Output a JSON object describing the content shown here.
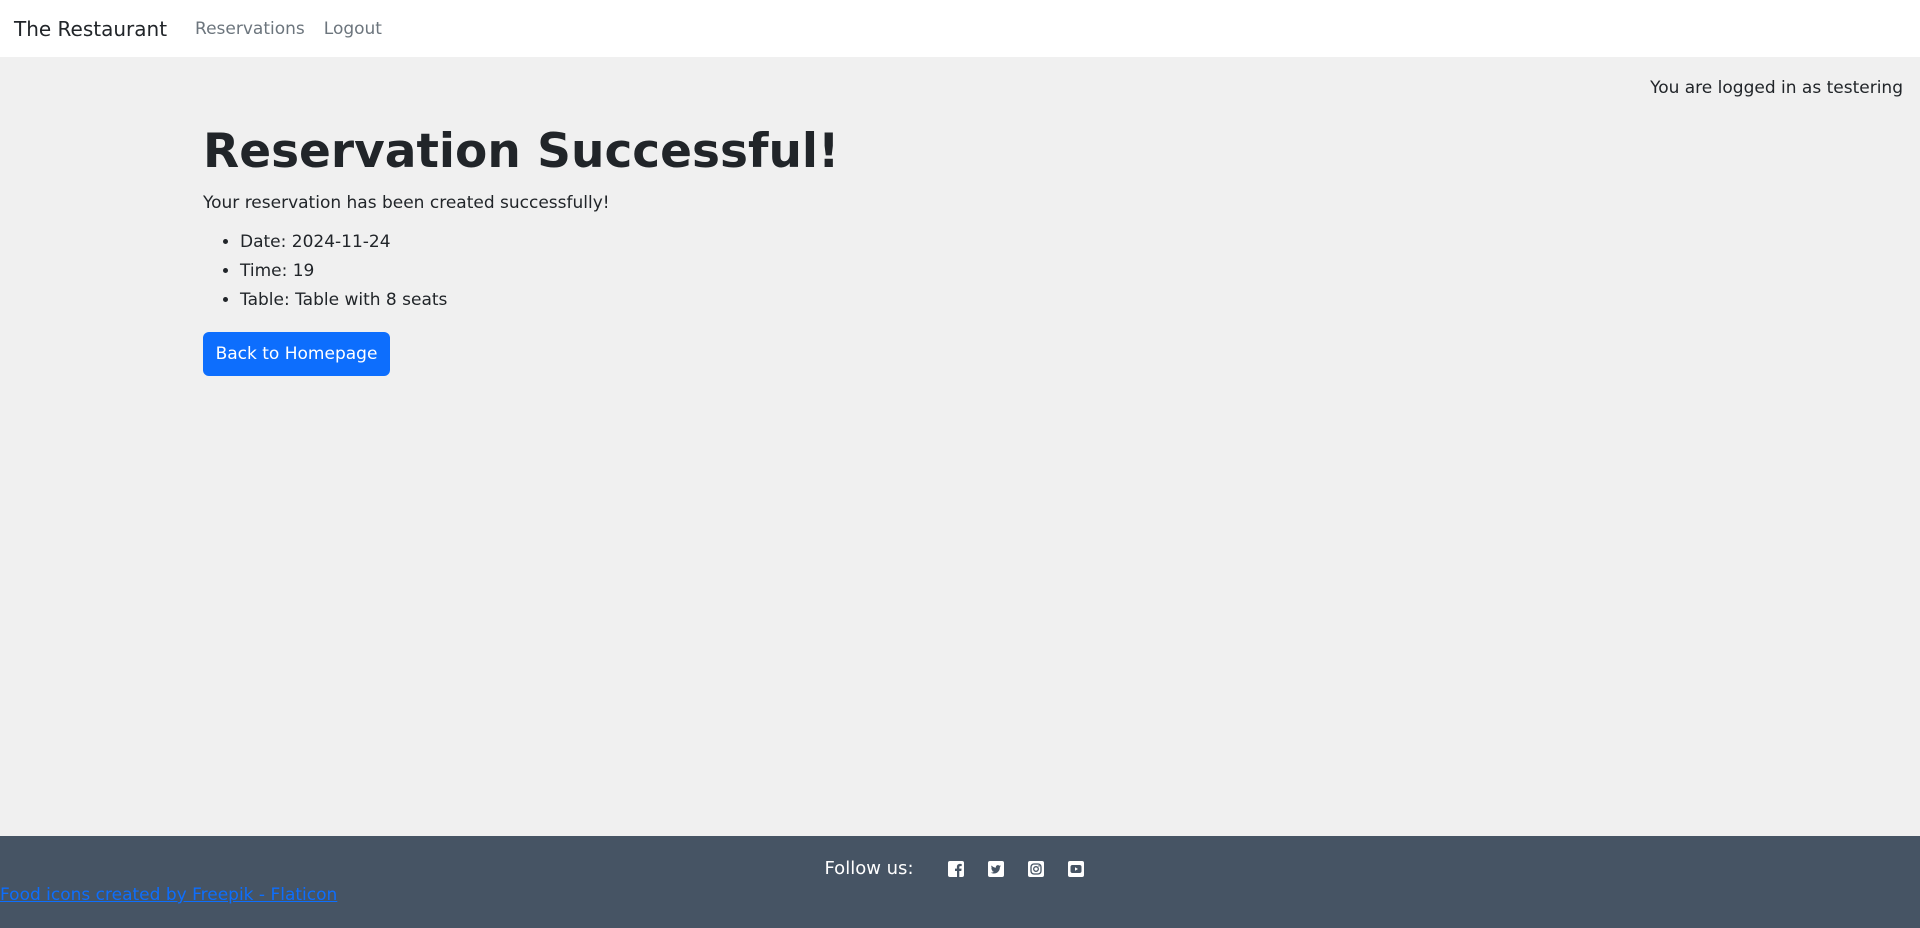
{
  "navbar": {
    "brand": "The Restaurant",
    "links": [
      {
        "label": "Reservations"
      },
      {
        "label": "Logout"
      }
    ]
  },
  "user": {
    "status_text": "You are logged in as testering"
  },
  "main": {
    "title": "Reservation Successful!",
    "message": "Your reservation has been created successfully!",
    "details": [
      "Date: 2024-11-24",
      "Time: 19",
      "Table: Table with 8 seats"
    ],
    "back_button_label": "Back to Homepage"
  },
  "footer": {
    "follow_label": "Follow us:",
    "social_icons": [
      "facebook-icon",
      "twitter-icon",
      "instagram-icon",
      "youtube-icon"
    ],
    "credit_text": "Food icons created by Freepik - Flaticon"
  },
  "colors": {
    "primary": "#0d6efd",
    "background": "#f0f0f0",
    "footer": "#465464",
    "text": "#212529",
    "nav_link": "#6c757d"
  }
}
